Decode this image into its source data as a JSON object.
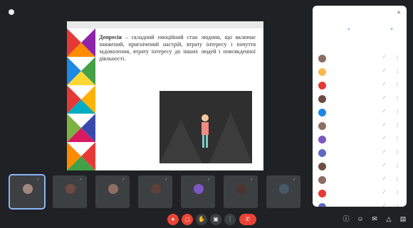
{
  "top": {
    "presenter_text": ""
  },
  "slide": {
    "header_text": "",
    "term": "Депресія",
    "body": "– складний емоційний стан людини, що включає знижений, пригнічений настрій, втрату інтересу і почуття задоволення, втрату інтересу до інших людей і повсякденної діяльності."
  },
  "thumbnails": [
    {
      "name": "",
      "color": "#a1887f"
    },
    {
      "name": "",
      "color": "#6d4c41"
    },
    {
      "name": "",
      "color": "#8d6e63"
    },
    {
      "name": "",
      "color": "#5d4037"
    },
    {
      "name": "",
      "color": "#7e57c2"
    },
    {
      "name": "",
      "color": "#4e342e"
    },
    {
      "name": "",
      "color": "#455a64"
    }
  ],
  "bottom": {
    "meeting_info": ""
  },
  "panel": {
    "title": "",
    "actions": [
      {
        "label": "",
        "icon": "user-plus-icon"
      },
      {
        "label": "",
        "icon": "add-person-icon"
      }
    ],
    "participants": [
      {
        "name": "",
        "color": "#8d6e63"
      },
      {
        "name": "",
        "color": "#ffb74d"
      },
      {
        "name": "",
        "color": "#e53935"
      },
      {
        "name": "",
        "color": "#6d4c41"
      },
      {
        "name": "",
        "color": "#1e88e5"
      },
      {
        "name": "",
        "color": "#8d6e63"
      },
      {
        "name": "",
        "color": "#7e57c2"
      },
      {
        "name": "",
        "color": "#5c6bc0"
      },
      {
        "name": "",
        "color": "#6d4c41"
      },
      {
        "name": "",
        "color": "#8d6e63"
      },
      {
        "name": "",
        "color": "#e53935"
      },
      {
        "name": "",
        "color": "#5c6bc0"
      }
    ]
  }
}
